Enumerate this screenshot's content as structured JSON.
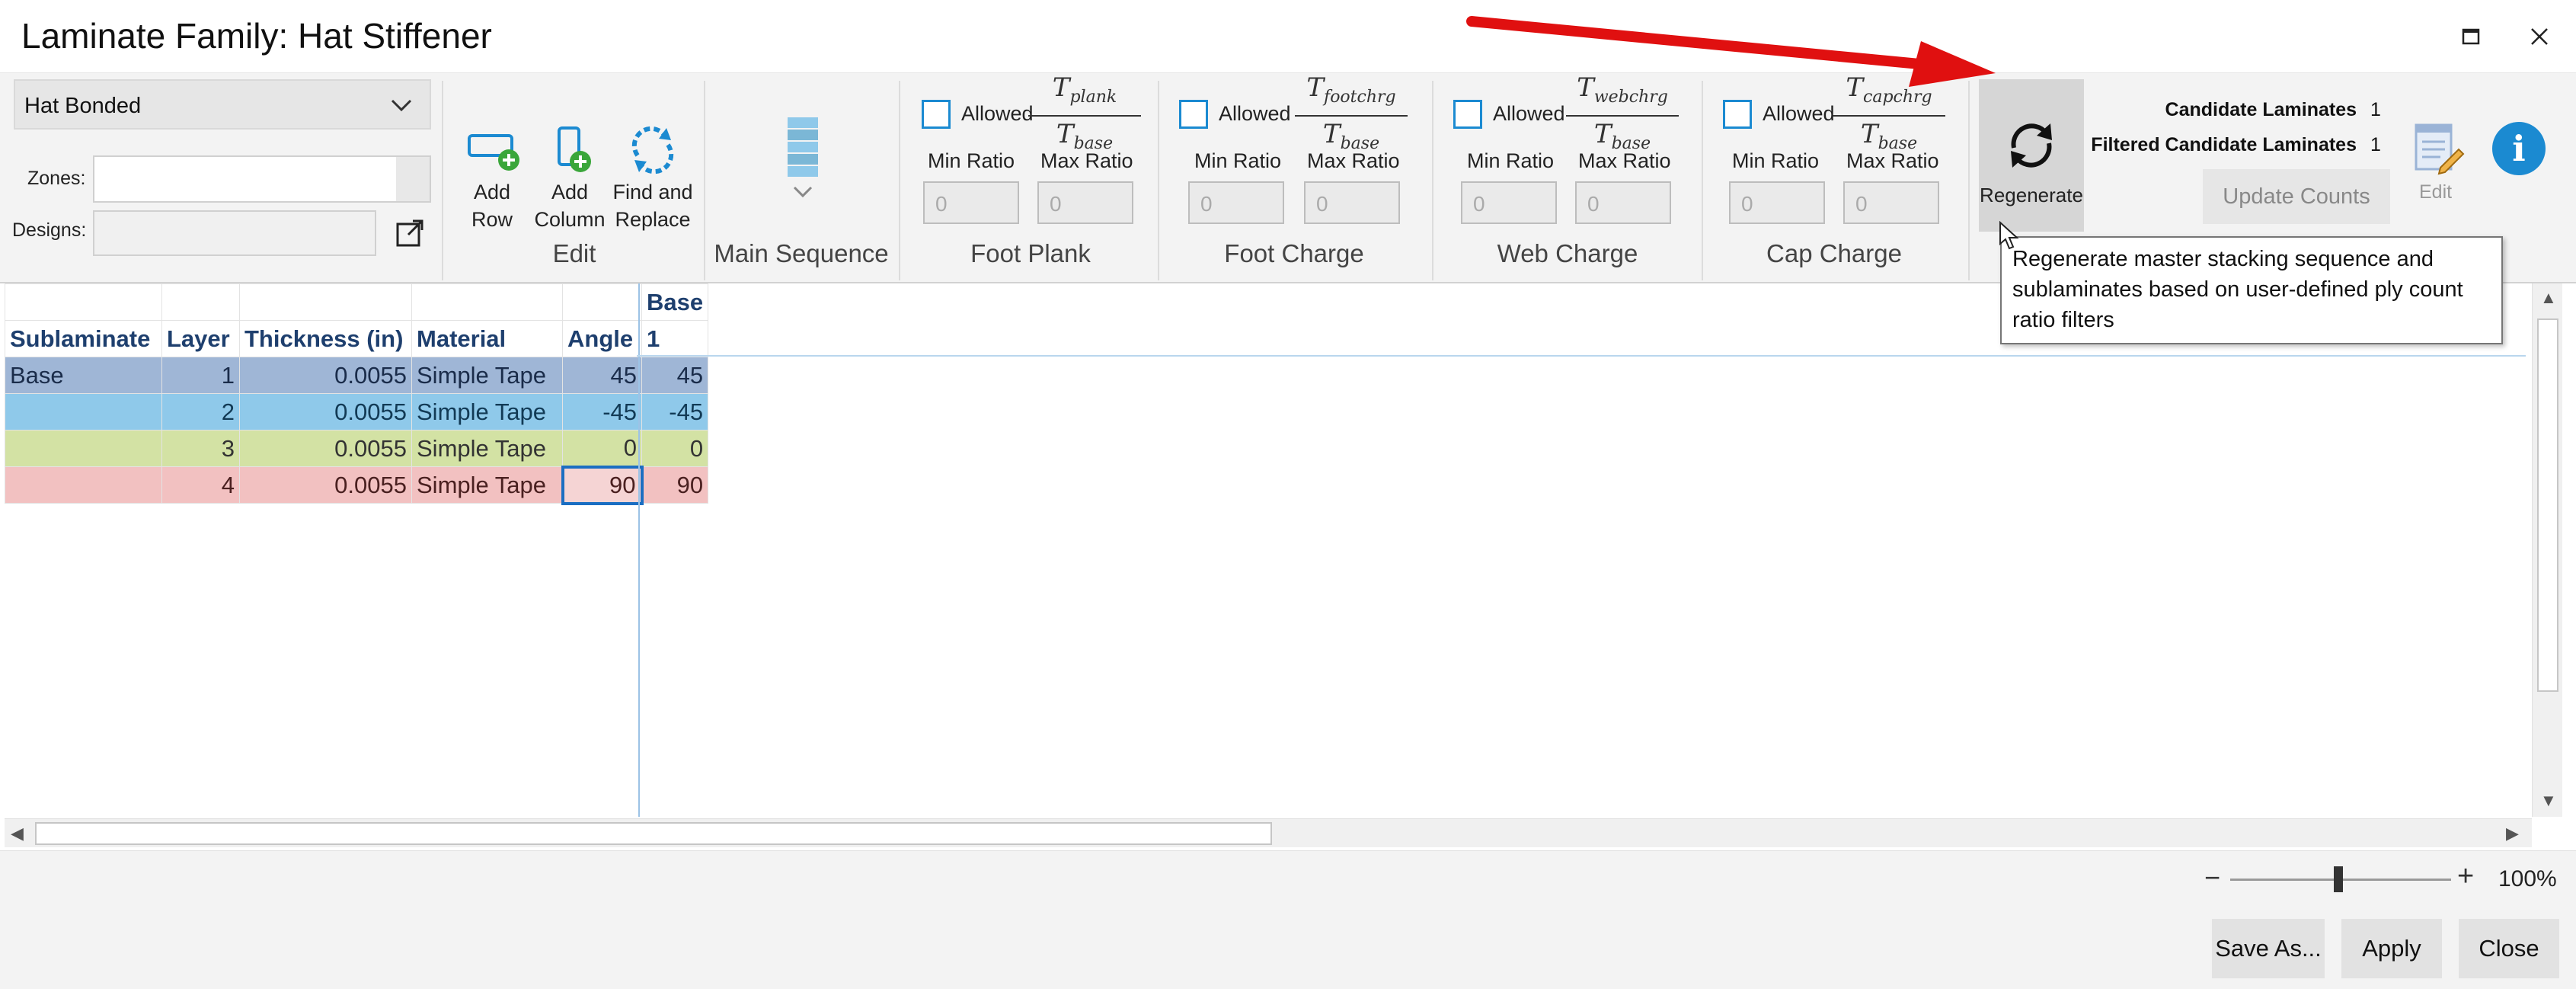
{
  "window": {
    "title": "Laminate Family: Hat Stiffener",
    "maximize_icon": "maximize-icon",
    "close_icon": "close-icon"
  },
  "ribbon": {
    "family_type": "Hat Bonded",
    "zones_label": "Zones:",
    "zones_value": "",
    "designs_label": "Designs:",
    "designs_value": "",
    "edit_group": {
      "label": "Edit",
      "add_row": "Add\nRow",
      "add_column": "Add\nColumn",
      "find_replace": "Find and\nReplace"
    },
    "main_sequence_label": "Main Sequence",
    "ratio_groups": [
      {
        "label": "Foot Plank",
        "allowed": "Allowed",
        "num_sub": "plank",
        "den_sub": "base",
        "min": "Min Ratio",
        "max": "Max Ratio",
        "min_val": "0",
        "max_val": "0"
      },
      {
        "label": "Foot Charge",
        "allowed": "Allowed",
        "num_sub": "footchrg",
        "den_sub": "base",
        "min": "Min Ratio",
        "max": "Max Ratio",
        "min_val": "0",
        "max_val": "0"
      },
      {
        "label": "Web Charge",
        "allowed": "Allowed",
        "num_sub": "webchrg",
        "den_sub": "base",
        "min": "Min Ratio",
        "max": "Max Ratio",
        "min_val": "0",
        "max_val": "0"
      },
      {
        "label": "Cap Charge",
        "allowed": "Allowed",
        "num_sub": "capchrg",
        "den_sub": "base",
        "min": "Min Ratio",
        "max": "Max Ratio",
        "min_val": "0",
        "max_val": "0"
      }
    ],
    "regenerate_label": "Regenerate",
    "candidate_label": "Candidate Laminates",
    "candidate_value": "1",
    "filtered_label": "Filtered Candidate Laminates",
    "filtered_value": "1",
    "update_counts": "Update Counts",
    "edit_label": "Edit",
    "info_glyph": "i"
  },
  "tooltip": "Regenerate master stacking sequence and sublaminates based on user-defined ply count ratio filters",
  "grid": {
    "top_header": {
      "base": "Base"
    },
    "headers": [
      "Sublaminate",
      "Layer",
      "Thickness (in)",
      "Material",
      "Angle",
      "1"
    ],
    "rows": [
      {
        "sublaminate": "Base",
        "layer": "1",
        "thickness": "0.0055",
        "material": "Simple Tape",
        "angle": "45",
        "base1": "45"
      },
      {
        "sublaminate": "",
        "layer": "2",
        "thickness": "0.0055",
        "material": "Simple Tape",
        "angle": "-45",
        "base1": "-45"
      },
      {
        "sublaminate": "",
        "layer": "3",
        "thickness": "0.0055",
        "material": "Simple Tape",
        "angle": "0",
        "base1": "0"
      },
      {
        "sublaminate": "",
        "layer": "4",
        "thickness": "0.0055",
        "material": "Simple Tape",
        "angle": "90",
        "base1": "90"
      }
    ]
  },
  "zoom": {
    "minus": "−",
    "plus": "+",
    "percent": "100%"
  },
  "footer": {
    "save_as": "Save As...",
    "apply": "Apply",
    "close": "Close"
  },
  "colors": {
    "accent": "#1b8ad1",
    "arrow": "#e01010",
    "row1": "#9fb6d6",
    "row2": "#8fc9ea",
    "row3": "#d3e2a4",
    "row4": "#f2c1c1"
  }
}
